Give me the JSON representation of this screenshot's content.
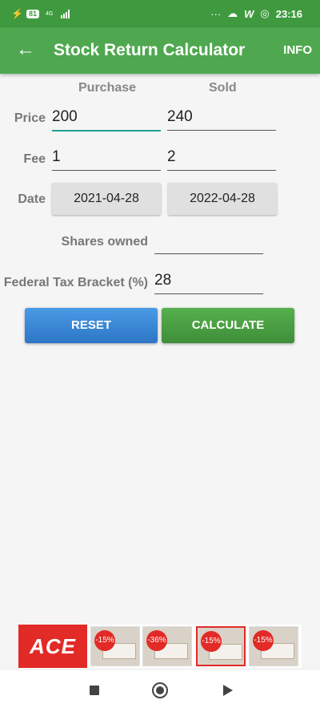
{
  "status_bar": {
    "battery": "81",
    "network": "4G",
    "time": "23:16",
    "more": "···"
  },
  "app_bar": {
    "back_icon": "arrow-left-icon",
    "title": "Stock Return Calculator",
    "info_label": "INFO"
  },
  "columns": {
    "purchase": "Purchase",
    "sold": "Sold"
  },
  "price": {
    "label": "Price",
    "purchase": "200",
    "sold": "240"
  },
  "fee": {
    "label": "Fee",
    "purchase": "1",
    "sold": "2"
  },
  "date": {
    "label": "Date",
    "purchase": "2021-04-28",
    "sold": "2022-04-28"
  },
  "shares": {
    "label": "Shares owned",
    "value": ""
  },
  "tax": {
    "label": "Federal Tax Bracket (%)",
    "value": "28"
  },
  "buttons": {
    "reset": "RESET",
    "calculate": "CALCULATE"
  },
  "ad": {
    "brand": "ACE",
    "items": [
      {
        "badge": "-15%"
      },
      {
        "badge": "-36%"
      },
      {
        "badge": "-15%"
      },
      {
        "badge": "-15%"
      }
    ]
  },
  "nav": {
    "recents": "square-icon",
    "home": "circle-icon",
    "back": "triangle-icon"
  },
  "colors": {
    "primary": "#4fa84f",
    "status": "#3f9a3f",
    "accent": "#1f9e8f",
    "reset": "#2d76c5",
    "calculate": "#3f8e39",
    "ad_red": "#e22a26"
  }
}
